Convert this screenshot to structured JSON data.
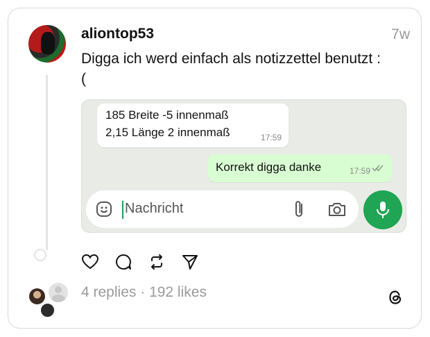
{
  "post": {
    "username": "aliontop53",
    "time_ago": "7w",
    "caption": "Digga ich werd einfach als notizzettel benutzt :\n("
  },
  "chat": {
    "incoming": {
      "line1": "185 Breite -5 innenmaß",
      "line2": "2,15 Länge 2 innenmaß",
      "time": "17:59"
    },
    "outgoing": {
      "text": "Korrekt digga danke",
      "time": "17:59",
      "status_icon": "double-check-icon"
    },
    "input_placeholder": "Nachricht",
    "accent": "#1fa553"
  },
  "footer": {
    "replies": "4 replies",
    "separator": " · ",
    "likes": "192 likes"
  },
  "icons": [
    "heart-icon",
    "comment-icon",
    "repost-icon",
    "share-icon",
    "threads-logo-icon"
  ]
}
